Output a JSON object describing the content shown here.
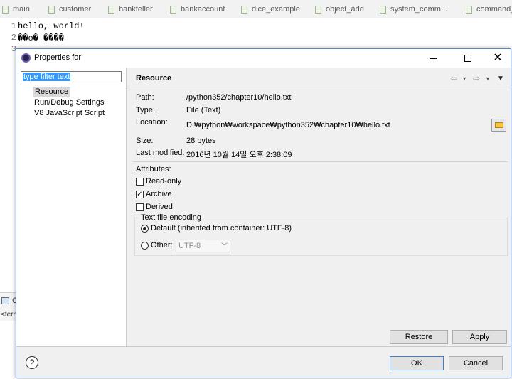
{
  "editor_tabs": [
    "main",
    "customer",
    "bankteller",
    "bankaccount",
    "dice_example",
    "object_add",
    "system_comm...",
    "command_..."
  ],
  "editor_lines": [
    {
      "num": "1",
      "text": "hello, world!"
    },
    {
      "num": "2",
      "text": "\u0000\u0000o\u0000 \u0000\u0000\u0000\u0000"
    },
    {
      "num": "3",
      "text": ""
    }
  ],
  "console": {
    "tab_label": "C",
    "term_label": "<term"
  },
  "dialog": {
    "title": "Properties for",
    "filter_placeholder": "type filter text",
    "tree": [
      "Resource",
      "Run/Debug Settings",
      "V8 JavaScript Script"
    ],
    "page_title": "Resource",
    "nav": {
      "back": "⇦",
      "forward": "⇨",
      "dropdown": "▾",
      "menu": "▼"
    },
    "fields": {
      "path_label": "Path:",
      "path_value": "/python352/chapter10/hello.txt",
      "type_label": "Type:",
      "type_value": "File  (Text)",
      "location_label": "Location:",
      "location_value": "D:₩python₩workspace₩python352₩chapter10₩hello.txt",
      "size_label": "Size:",
      "size_value": "28  bytes",
      "modified_label": "Last modified:",
      "modified_value": "2016년 10월 14일 오후 2:38:09"
    },
    "attributes": {
      "label": "Attributes:",
      "read_only": "Read-only",
      "archive": "Archive",
      "derived": "Derived"
    },
    "encoding": {
      "legend": "Text file encoding",
      "default_option": "Default (inherited from container: UTF-8)",
      "other_option": "Other:",
      "other_value": "UTF-8"
    },
    "buttons": {
      "restore": "Restore Defaults",
      "apply": "Apply",
      "ok": "OK",
      "cancel": "Cancel",
      "help": "?"
    }
  }
}
